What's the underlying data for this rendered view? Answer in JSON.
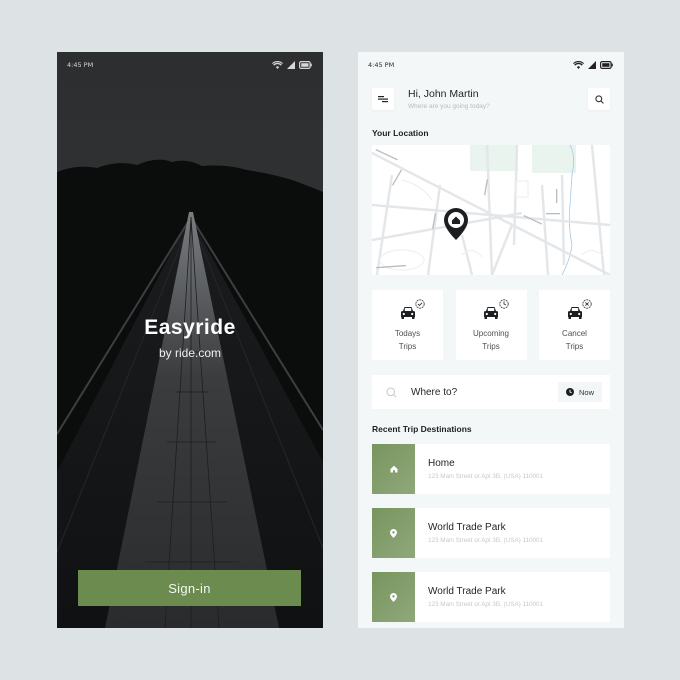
{
  "splash_screen": {
    "status_bar": {
      "time": "4:45 PM"
    },
    "brand_title": "Easyride",
    "brand_subtitle": "by ride.com",
    "signin_label": "Sign-in",
    "colors": {
      "accent": "#6b8c4e",
      "background": "#0c0d0e"
    }
  },
  "home_screen": {
    "status_bar": {
      "time": "4:45 PM"
    },
    "header": {
      "greeting": "Hi, John Martin",
      "subtitle": "Where are you going today?",
      "menu_icon": "menu-icon",
      "search_icon": "search-icon"
    },
    "location_section": {
      "title": "Your Location",
      "marker_icon": "home-pin-icon"
    },
    "trip_cards": [
      {
        "line1": "Todays",
        "line2": "Trips",
        "icon": "car-icon",
        "badge": "check-circle-icon"
      },
      {
        "line1": "Upcoming",
        "line2": "Trips",
        "icon": "car-icon",
        "badge": "clock-icon"
      },
      {
        "line1": "Cancel",
        "line2": "Trips",
        "icon": "car-icon",
        "badge": "x-circle-icon"
      }
    ],
    "search": {
      "placeholder": "Where to?",
      "time_button": "Now",
      "time_icon": "clock-icon"
    },
    "recent_section": {
      "title": "Recent Trip Destinations"
    },
    "destinations": [
      {
        "name": "Home",
        "address": "123 Main Street or Apt 3B, (USA) 110001",
        "icon": "home-icon"
      },
      {
        "name": "World Trade Park",
        "address": "123 Main Street or Apt 3B, (USA) 110001",
        "icon": "location-pin-icon"
      },
      {
        "name": "World Trade Park",
        "address": "123 Main Street or Apt 3B, (USA) 110001",
        "icon": "location-pin-icon"
      }
    ],
    "colors": {
      "accent": "#7a975f",
      "background": "#f4f7f8",
      "card": "#ffffff"
    }
  }
}
